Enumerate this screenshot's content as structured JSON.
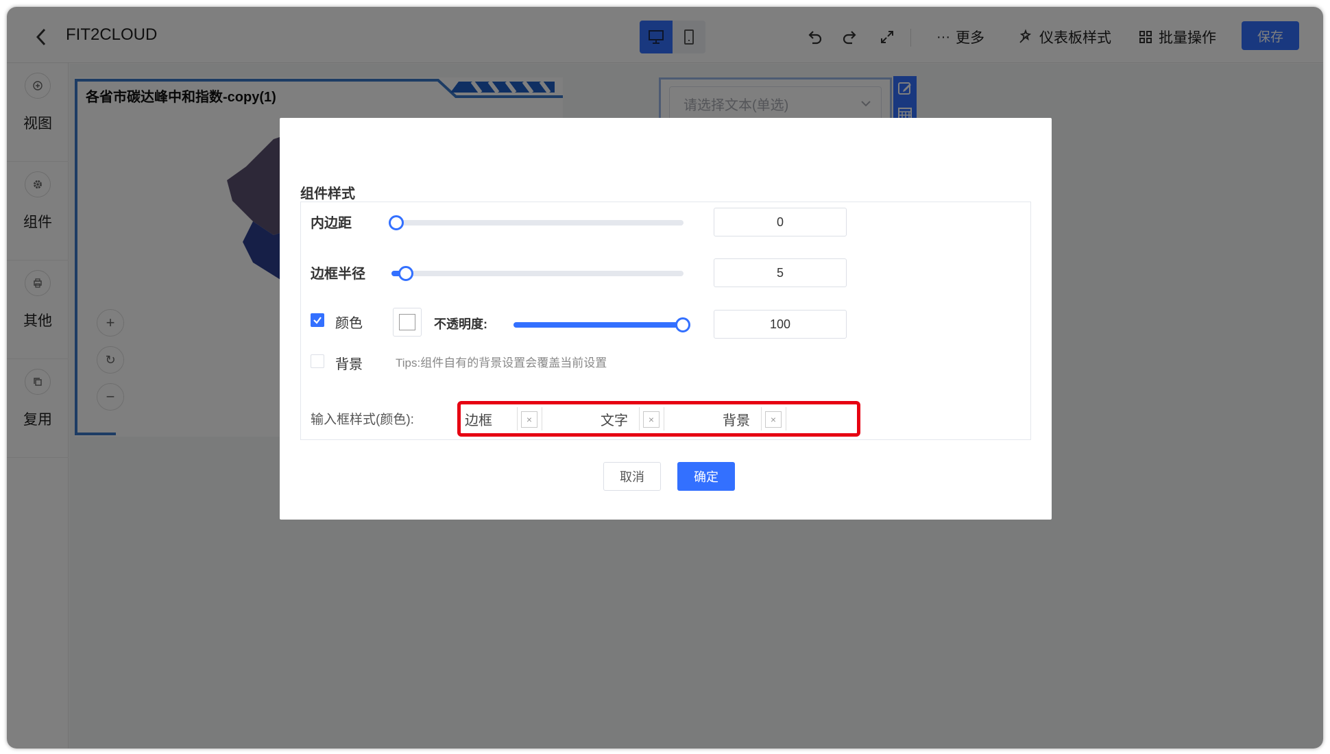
{
  "header": {
    "title": "FIT2CLOUD",
    "more_label": "更多",
    "theme_label": "仪表板样式",
    "batch_label": "批量操作",
    "save_label": "保存"
  },
  "sidebar": {
    "items": [
      {
        "label": "视图",
        "icon": "plus-circle-icon"
      },
      {
        "label": "组件",
        "icon": "gear-icon"
      },
      {
        "label": "其他",
        "icon": "printer-icon"
      },
      {
        "label": "复用",
        "icon": "copy-icon"
      }
    ]
  },
  "canvas": {
    "chart_title": "各省市碳达峰中和指数-copy(1)",
    "filter_placeholder": "请选择文本(单选)"
  },
  "dialog": {
    "section_title": "组件样式",
    "padding": {
      "label": "内边距",
      "value": "0",
      "slider_fraction": 0.0
    },
    "radius": {
      "label": "边框半径",
      "value": "5",
      "slider_fraction": 0.05
    },
    "color": {
      "label": "颜色",
      "checked": true,
      "opacity_label": "不透明度:",
      "opacity_value": "100",
      "opacity_fraction": 1.0
    },
    "background": {
      "label": "背景",
      "checked": false,
      "tips": "Tips:组件自有的背景设置会覆盖当前设置"
    },
    "input_style": {
      "label": "输入框样式(颜色):",
      "tags": [
        "边框",
        "文字",
        "背景"
      ]
    },
    "cancel_label": "取消",
    "confirm_label": "确定"
  },
  "colors": {
    "primary": "#3370ff",
    "highlight": "#e60012",
    "overlay": "rgba(0,0,0,0.5)"
  }
}
